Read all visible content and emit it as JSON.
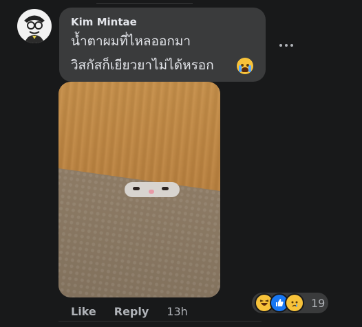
{
  "comment": {
    "author": "Kim Mintae",
    "text_line1": "น้ำตาผมที่ไหลออกมา",
    "text_line2": "วิสกัสก็เยียวยาไม่ได้หรอก",
    "emoji_name": "loudly-crying-face"
  },
  "actions": {
    "like_label": "Like",
    "reply_label": "Reply",
    "timestamp": "13h"
  },
  "reactions": {
    "count": "19",
    "types": [
      "haha",
      "like",
      "sad"
    ]
  },
  "colors": {
    "background": "#18191a",
    "bubble": "#3a3b3c",
    "text_primary": "#e4e6eb",
    "text_secondary": "#b0b3b8",
    "like_blue": "#1877f2"
  }
}
